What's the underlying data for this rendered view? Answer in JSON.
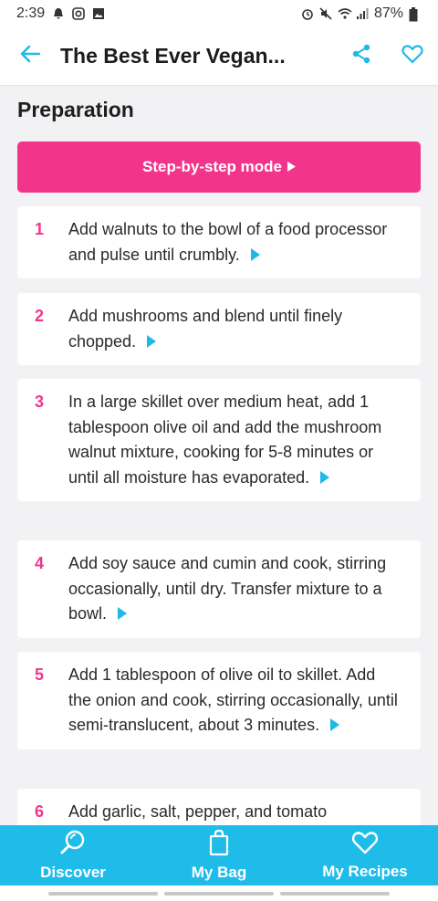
{
  "status_bar": {
    "time": "2:39",
    "battery": "87%"
  },
  "header": {
    "title": "The Best Ever Vegan..."
  },
  "preparation": {
    "title": "Preparation",
    "step_mode_label": "Step-by-step mode"
  },
  "steps": [
    {
      "num": "1",
      "text": "Add walnuts to the bowl of a food processor and pulse until crumbly."
    },
    {
      "num": "2",
      "text": "Add mushrooms and blend until finely chopped."
    },
    {
      "num": "3",
      "text": "In a large skillet over medium heat, add 1 tablespoon olive oil and add the mushroom walnut mixture, cooking for 5-8 minutes or until all moisture has evaporated."
    },
    {
      "num": "4",
      "text": "Add soy sauce and cumin and cook, stirring occasionally, until dry. Transfer mixture to a bowl."
    },
    {
      "num": "5",
      "text": "Add 1 tablespoon of olive oil to skillet. Add the onion and cook, stirring occasionally, until semi-translucent, about 3 minutes."
    },
    {
      "num": "6",
      "text": "Add garlic, salt, pepper, and tomato"
    }
  ],
  "bottom_nav": {
    "discover": "Discover",
    "my_bag": "My Bag",
    "my_recipes": "My Recipes"
  },
  "colors": {
    "accent_pink": "#f2358a",
    "accent_blue": "#1fbcea"
  },
  "icons": [
    "back-arrow-icon",
    "share-icon",
    "heart-icon",
    "discover-icon",
    "bag-icon",
    "heart-icon",
    "play-icon"
  ]
}
